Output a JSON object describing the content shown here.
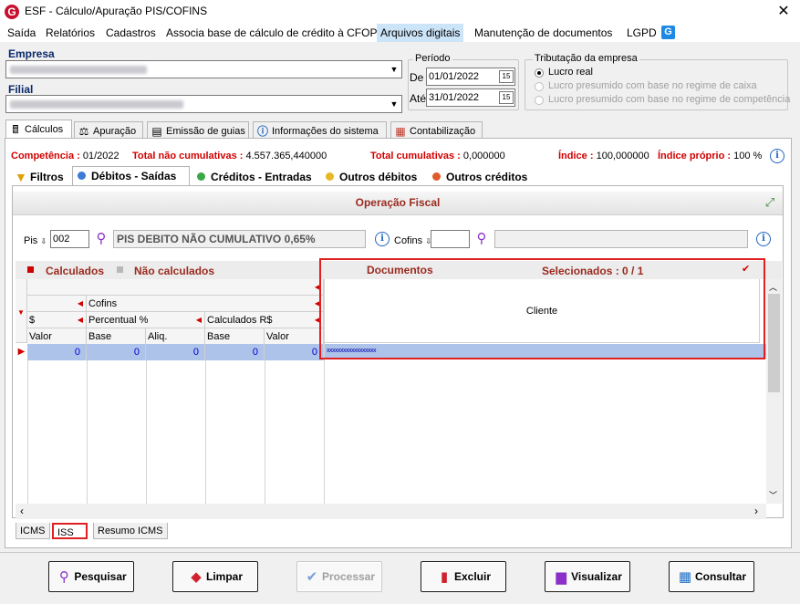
{
  "window": {
    "title": "ESF - Cálculo/Apuração PIS/COFINS",
    "app_icon_letter": "G",
    "close_glyph": "✕"
  },
  "menu": [
    "Saída",
    "Relatórios",
    "Cadastros",
    "Associa base de cálculo de crédito à CFOP",
    "Arquivos digitais",
    "Manutenção de documentos",
    "LGPD"
  ],
  "lgpd_icon_letter": "G",
  "empresa": {
    "label": "Empresa",
    "value": ""
  },
  "filial": {
    "label": "Filial",
    "value": ""
  },
  "periodo": {
    "title": "Período",
    "de_label": "De",
    "de_value": "01/01/2022",
    "ate_label": "Até",
    "ate_value": "31/01/2022",
    "cal_glyph": "15"
  },
  "tributacao": {
    "title": "Tributação da empresa",
    "options": [
      "Lucro real",
      "Lucro presumido com base no regime de caixa",
      "Lucro presumido com base no regime de competência"
    ],
    "selected": 0
  },
  "tabs": [
    "Cálculos",
    "Apuração",
    "Emissão de guias",
    "Informações do sistema",
    "Contabilização"
  ],
  "summary": {
    "competencia_label": "Competência :",
    "competencia_value": "01/2022",
    "nao_cumul_label": "Total não cumulativas :",
    "nao_cumul_value": "4.557.365,440000",
    "cumul_label": "Total cumulativas :",
    "cumul_value": "0,000000",
    "indice_label": "Índice :",
    "indice_value": "100,000000",
    "indice_proprio_label": "Índice próprio :",
    "indice_proprio_value": "100 %"
  },
  "subtabs": [
    "Filtros",
    "Débitos - Saídas",
    "Créditos - Entradas",
    "Outros débitos",
    "Outros créditos"
  ],
  "operacao": {
    "title": "Operação Fiscal",
    "pis_label": "Pis",
    "pis_code": "002",
    "pis_desc": "PIS DEBITO NÃO CUMULATIVO 0,65%",
    "cofins_label": "Cofins",
    "cofins_code": "",
    "cofins_desc": ""
  },
  "grid": {
    "legend_calc": "Calculados",
    "legend_nocalc": "Não calculados",
    "docs_label": "Documentos",
    "selecionados": "Selecionados : 0 / 1",
    "cofins": "Cofins",
    "dollar": "$",
    "percentual": "Percentual %",
    "calculados_rs": "Calculados R$",
    "cols": [
      "Valor",
      "Base",
      "Aliq.",
      "Base",
      "Valor"
    ],
    "row": [
      "0",
      "0",
      "0",
      "0",
      "0"
    ],
    "cliente_header": "Cliente",
    "cliente_value": "xxxxxxxxxxxxxxxxxx"
  },
  "bottom_tabs": [
    "ICMS",
    "ISS",
    "Resumo ICMS"
  ],
  "buttons": [
    "Pesquisar",
    "Limpar",
    "Processar",
    "Excluir",
    "Visualizar",
    "Consultar"
  ]
}
